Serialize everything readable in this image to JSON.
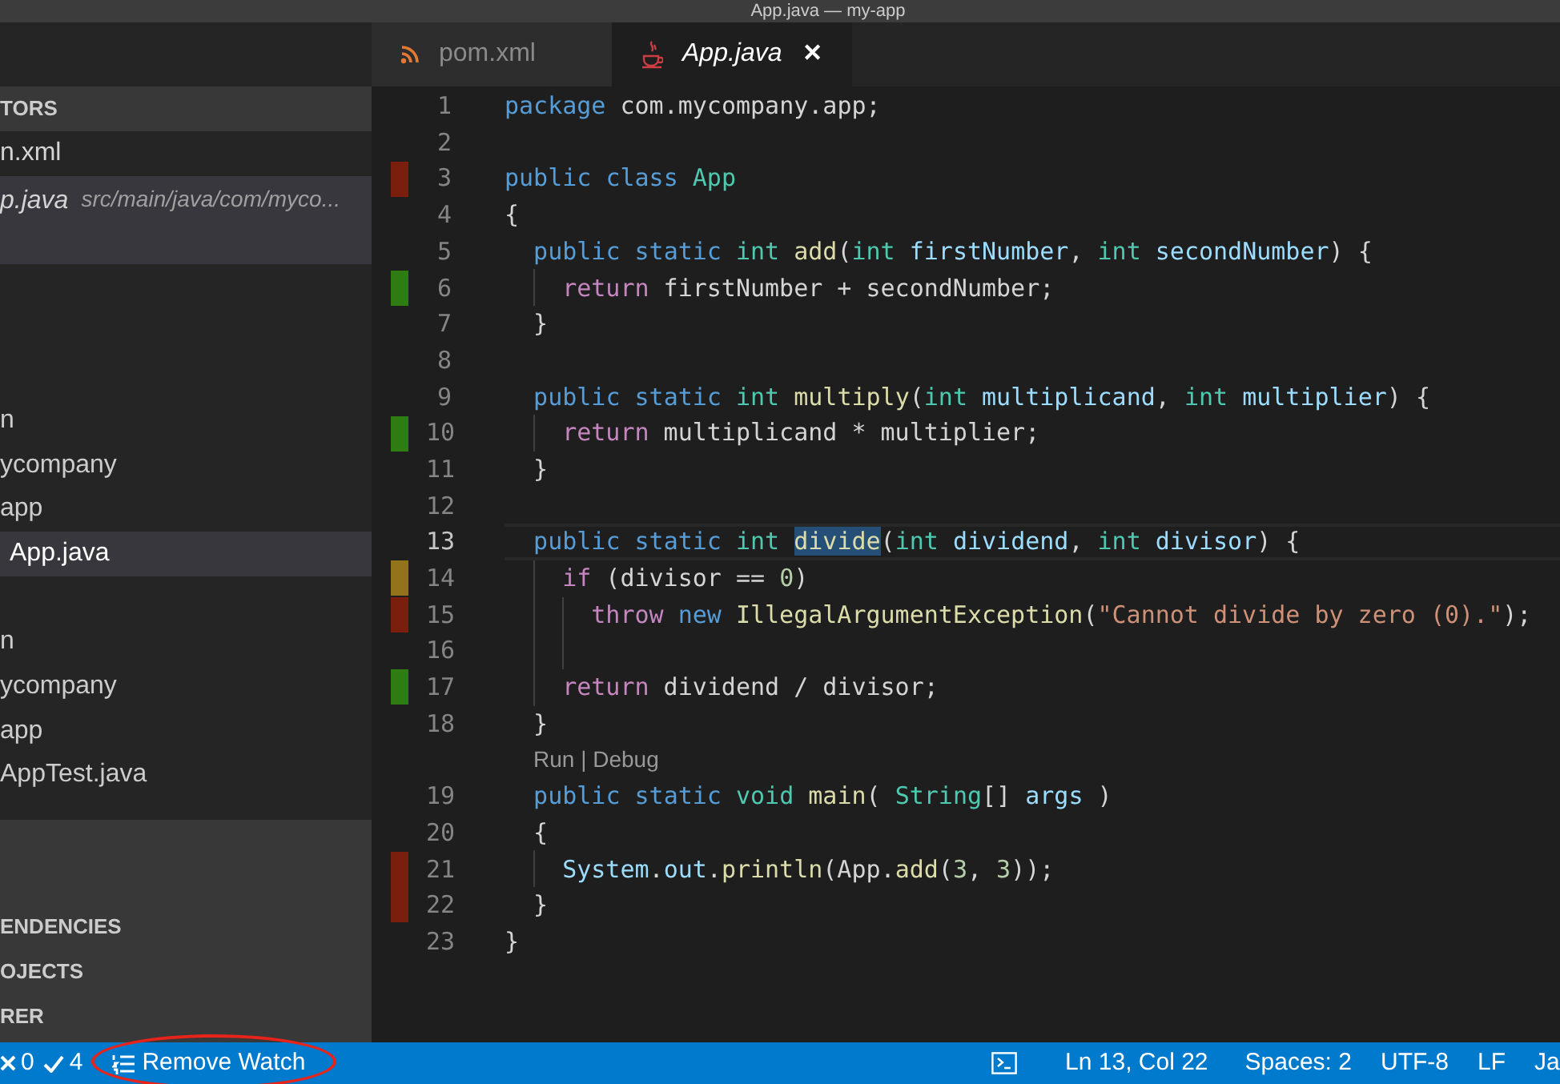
{
  "window": {
    "title": "App.java — my-app"
  },
  "tabs": [
    {
      "label": "pom.xml",
      "kind": "xml",
      "selected": false
    },
    {
      "label": "App.java",
      "kind": "java",
      "selected": true,
      "close": "✕"
    }
  ],
  "sidebar": {
    "open_editors": {
      "header": "TORS",
      "items": [
        {
          "name": "n.xml",
          "selected": false
        },
        {
          "name": "p.java",
          "path": "src/main/java/com/myco...",
          "selected": true
        }
      ]
    },
    "tree": [
      {
        "name": "n",
        "selected": false,
        "children": [
          {
            "name": "ycompany",
            "selected": false,
            "children": [
              {
                "name": "app",
                "selected": false,
                "children": [
                  {
                    "name": "App.java",
                    "selected": true
                  }
                ]
              }
            ]
          }
        ]
      },
      {
        "name": "n",
        "selected": false,
        "children": [
          {
            "name": "ycompany",
            "selected": false,
            "children": [
              {
                "name": "app",
                "selected": false,
                "children": [
                  {
                    "name": "AppTest.java",
                    "selected": false
                  }
                ]
              }
            ]
          }
        ]
      }
    ],
    "sections": [
      "ENDENCIES",
      "OJECTS",
      "RER"
    ]
  },
  "editor": {
    "lines": [
      {
        "number": "1",
        "current": false,
        "tokens": [
          {
            "kind": "kw",
            "text": "package"
          },
          {
            "kind": "plain",
            "text": " com.mycompany.app;"
          }
        ]
      },
      {
        "number": "2",
        "current": false
      },
      {
        "number": "3",
        "current": false,
        "color": "#7a1f0e",
        "tokens": [
          {
            "kind": "kw",
            "text": "public"
          },
          {
            "kind": "kw",
            "text": " class"
          },
          {
            "kind": "type",
            "text": " App"
          }
        ]
      },
      {
        "number": "4",
        "current": false,
        "tokens": [
          {
            "kind": "plain",
            "text": "{"
          }
        ]
      },
      {
        "number": "5",
        "current": false,
        "tokens": [
          {
            "kind": "kw",
            "text": "  public"
          },
          {
            "kind": "kw",
            "text": " static"
          },
          {
            "kind": "type",
            "text": " int"
          },
          {
            "kind": "fn",
            "text": " add"
          },
          {
            "kind": "plain",
            "text": "("
          },
          {
            "kind": "type",
            "text": "int"
          },
          {
            "kind": "var",
            "text": " firstNumber"
          },
          {
            "kind": "plain",
            "text": ", "
          },
          {
            "kind": "type",
            "text": "int"
          },
          {
            "kind": "var",
            "text": " secondNumber"
          },
          {
            "kind": "plain",
            "text": ") {"
          }
        ]
      },
      {
        "number": "6",
        "current": false,
        "color": "#2f7d12",
        "tokens": [
          {
            "kind": "ctrl",
            "text": "    return"
          },
          {
            "kind": "plain",
            "text": " firstNumber + secondNumber;"
          }
        ]
      },
      {
        "number": "7",
        "current": false,
        "tokens": [
          {
            "kind": "plain",
            "text": "  }"
          }
        ]
      },
      {
        "number": "8",
        "current": false
      },
      {
        "number": "9",
        "current": false,
        "tokens": [
          {
            "kind": "kw",
            "text": "  public"
          },
          {
            "kind": "kw",
            "text": " static"
          },
          {
            "kind": "type",
            "text": " int"
          },
          {
            "kind": "fn",
            "text": " multiply"
          },
          {
            "kind": "plain",
            "text": "("
          },
          {
            "kind": "type",
            "text": "int"
          },
          {
            "kind": "var",
            "text": " multiplicand"
          },
          {
            "kind": "plain",
            "text": ", "
          },
          {
            "kind": "type",
            "text": "int"
          },
          {
            "kind": "var",
            "text": " multiplier"
          },
          {
            "kind": "plain",
            "text": ") {"
          }
        ]
      },
      {
        "number": "10",
        "current": false,
        "color": "#2f7d12",
        "tokens": [
          {
            "kind": "ctrl",
            "text": "    return"
          },
          {
            "kind": "plain",
            "text": " multiplicand * multiplier;"
          }
        ]
      },
      {
        "number": "11",
        "current": false,
        "tokens": [
          {
            "kind": "plain",
            "text": "  }"
          }
        ]
      },
      {
        "number": "12",
        "current": false
      },
      {
        "number": "13",
        "current": true,
        "tokens": [
          {
            "kind": "kw",
            "text": "  public"
          },
          {
            "kind": "kw",
            "text": " static"
          },
          {
            "kind": "type",
            "text": " int "
          },
          {
            "kind": "fn_sel",
            "text": "divide"
          },
          {
            "kind": "plain",
            "text": "("
          },
          {
            "kind": "type",
            "text": "int"
          },
          {
            "kind": "var",
            "text": " dividend"
          },
          {
            "kind": "plain",
            "text": ", "
          },
          {
            "kind": "type",
            "text": "int"
          },
          {
            "kind": "var",
            "text": " divisor"
          },
          {
            "kind": "plain",
            "text": ") {"
          }
        ]
      },
      {
        "number": "14",
        "current": false,
        "color": "#94741a",
        "tokens": [
          {
            "kind": "ctrl",
            "text": "    if"
          },
          {
            "kind": "plain",
            "text": " (divisor == "
          },
          {
            "kind": "num",
            "text": "0"
          },
          {
            "kind": "plain",
            "text": ")"
          }
        ]
      },
      {
        "number": "15",
        "current": false,
        "color": "#7a1f0e",
        "tokens": [
          {
            "kind": "ctrl",
            "text": "      throw"
          },
          {
            "kind": "kw",
            "text": " new"
          },
          {
            "kind": "fn",
            "text": " IllegalArgumentException"
          },
          {
            "kind": "plain",
            "text": "("
          },
          {
            "kind": "str",
            "text": "\"Cannot divide by zero (0).\""
          },
          {
            "kind": "plain",
            "text": ");"
          }
        ]
      },
      {
        "number": "16",
        "current": false
      },
      {
        "number": "17",
        "current": false,
        "color": "#2f7d12",
        "tokens": [
          {
            "kind": "ctrl",
            "text": "    return"
          },
          {
            "kind": "plain",
            "text": " dividend / divisor;"
          }
        ]
      },
      {
        "number": "18",
        "current": false,
        "tokens": [
          {
            "kind": "plain",
            "text": "  }"
          }
        ],
        "codelens": "Run | Debug"
      },
      {
        "number": "19",
        "current": false,
        "tokens": [
          {
            "kind": "kw",
            "text": "  public"
          },
          {
            "kind": "kw",
            "text": " static"
          },
          {
            "kind": "type",
            "text": " void"
          },
          {
            "kind": "fn",
            "text": " main"
          },
          {
            "kind": "plain",
            "text": "( "
          },
          {
            "kind": "type",
            "text": "String"
          },
          {
            "kind": "plain",
            "text": "[] "
          },
          {
            "kind": "var",
            "text": "args"
          },
          {
            "kind": "plain",
            "text": " )"
          }
        ]
      },
      {
        "number": "20",
        "current": false,
        "tokens": [
          {
            "kind": "plain",
            "text": "  {"
          }
        ]
      },
      {
        "number": "21",
        "current": false,
        "color": "#7a1f0e",
        "tokens": [
          {
            "kind": "var",
            "text": "    System"
          },
          {
            "kind": "plain",
            "text": "."
          },
          {
            "kind": "var",
            "text": "out"
          },
          {
            "kind": "plain",
            "text": "."
          },
          {
            "kind": "fn",
            "text": "println"
          },
          {
            "kind": "plain",
            "text": "(App."
          },
          {
            "kind": "fn",
            "text": "add"
          },
          {
            "kind": "plain",
            "text": "("
          },
          {
            "kind": "num",
            "text": "3"
          },
          {
            "kind": "plain",
            "text": ", "
          },
          {
            "kind": "num",
            "text": "3"
          },
          {
            "kind": "plain",
            "text": "));"
          }
        ]
      },
      {
        "number": "22",
        "current": false,
        "color": "#7a1f0e",
        "tokens": [
          {
            "kind": "plain",
            "text": "  }"
          }
        ]
      },
      {
        "number": "23",
        "current": false,
        "tokens": [
          {
            "kind": "plain",
            "text": "}"
          }
        ]
      }
    ]
  },
  "status_bar": {
    "errors": "0",
    "checks": "4",
    "watch_button": "Remove Watch",
    "position": "Ln 13, Col 22",
    "spaces": "Spaces: 2",
    "encoding": "UTF-8",
    "eol": "LF",
    "language": "Ja"
  }
}
